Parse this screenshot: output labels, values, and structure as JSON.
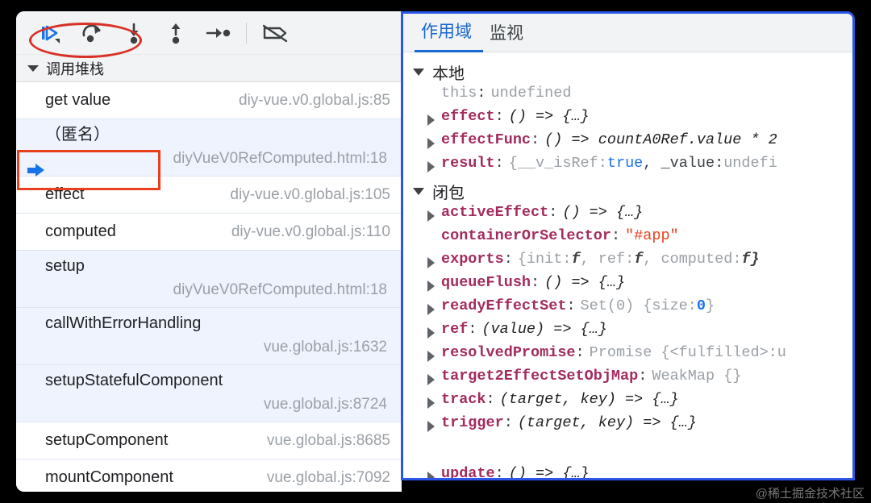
{
  "toolbar": {
    "buttons": [
      {
        "name": "resume-script-execution",
        "icon": "resume-icon"
      },
      {
        "name": "step-over-next-function-call",
        "icon": "step-over-icon"
      },
      {
        "name": "step-into-next-function-call",
        "icon": "step-into-icon"
      },
      {
        "name": "step-out-of-current-function",
        "icon": "step-out-icon"
      },
      {
        "name": "step",
        "icon": "step-icon"
      },
      {
        "name": "deactivate-breakpoints",
        "icon": "deactivate-breakpoints-icon"
      }
    ]
  },
  "call_stack": {
    "section_title": "调用堆栈",
    "expanded": true,
    "rows": [
      {
        "fn": "get value",
        "src": "diy-vue.v0.global.js:85",
        "layout": "one-line",
        "annotation": "ellipse"
      },
      {
        "fn": "（匿名）",
        "src": "diyVueV0RefComputed.html:18",
        "layout": "two-line",
        "annotation": ""
      },
      {
        "fn": "effect",
        "src": "diy-vue.v0.global.js:105",
        "layout": "one-line",
        "annotation": ""
      },
      {
        "fn": "computed",
        "src": "diy-vue.v0.global.js:110",
        "layout": "one-line",
        "annotation": "rect",
        "marker": "blue-arrow"
      },
      {
        "fn": "setup",
        "src": "diyVueV0RefComputed.html:18",
        "layout": "two-line",
        "annotation": ""
      },
      {
        "fn": "callWithErrorHandling",
        "src": "vue.global.js:1632",
        "layout": "two-line",
        "annotation": ""
      },
      {
        "fn": "setupStatefulComponent",
        "src": "vue.global.js:8724",
        "layout": "two-line",
        "annotation": ""
      },
      {
        "fn": "setupComponent",
        "src": "vue.global.js:8685",
        "layout": "one-line",
        "annotation": ""
      },
      {
        "fn": "mountComponent",
        "src": "vue.global.js:7092",
        "layout": "one-line",
        "annotation": ""
      }
    ]
  },
  "scope_panel": {
    "tabs": [
      {
        "label": "作用域",
        "active": true
      },
      {
        "label": "监视",
        "active": false
      }
    ],
    "groups": [
      {
        "label": "本地",
        "expanded": true,
        "props": [
          {
            "expandable": false,
            "name": "this",
            "name_dim": true,
            "value": "undefined",
            "value_style": "dim"
          },
          {
            "expandable": true,
            "name": "effect",
            "value": "() => {…}",
            "value_style": "fn"
          },
          {
            "expandable": true,
            "name": "effectFunc",
            "value": "() => countA0Ref.value * 2",
            "value_style": "fn"
          },
          {
            "expandable": true,
            "name": "result",
            "value_parts": [
              {
                "t": "{__v_isRef: ",
                "s": "dim"
              },
              {
                "t": "true",
                "s": "bool"
              },
              {
                "t": ", _value: ",
                "s": "plain"
              },
              {
                "t": "undefi",
                "s": "dim"
              }
            ]
          }
        ]
      },
      {
        "label": "闭包",
        "expanded": true,
        "props": [
          {
            "expandable": true,
            "name": "activeEffect",
            "value": "() => {…}",
            "value_style": "fn"
          },
          {
            "expandable": false,
            "name": "containerOrSelector",
            "value": "\"#app\"",
            "value_style": "str"
          },
          {
            "expandable": true,
            "name": "exports",
            "value_parts": [
              {
                "t": "{init: ",
                "s": "dim"
              },
              {
                "t": "f",
                "s": "italic-f"
              },
              {
                "t": ", ref: ",
                "s": "dim"
              },
              {
                "t": "f",
                "s": "italic-f"
              },
              {
                "t": ", computed: ",
                "s": "dim"
              },
              {
                "t": "f}",
                "s": "italic-f"
              }
            ]
          },
          {
            "expandable": true,
            "name": "queueFlush",
            "value": "() => {…}",
            "value_style": "fn"
          },
          {
            "expandable": true,
            "name": "readyEffectSet",
            "value_parts": [
              {
                "t": "Set(0) {size: ",
                "s": "dim"
              },
              {
                "t": "0",
                "s": "num"
              },
              {
                "t": "}",
                "s": "dim"
              }
            ]
          },
          {
            "expandable": true,
            "name": "ref",
            "value": "(value) => {…}",
            "value_style": "fn"
          },
          {
            "expandable": true,
            "name": "resolvedPromise",
            "value_parts": [
              {
                "t": "Promise {<fulfilled>: ",
                "s": "dim"
              },
              {
                "t": "u",
                "s": "dim"
              }
            ]
          },
          {
            "expandable": true,
            "name": "target2EffectSetObjMap",
            "value": "WeakMap {}",
            "value_style": "dim"
          },
          {
            "expandable": true,
            "name": "track",
            "value": "(target, key) => {…}",
            "value_style": "fn"
          },
          {
            "expandable": true,
            "name": "trigger",
            "value": "(target, key) => {…}",
            "value_style": "fn"
          },
          {
            "expandable": true,
            "name": "update",
            "value": "() => {…}",
            "value_style": "fn",
            "clipped": true
          }
        ]
      }
    ]
  },
  "watermark": "@稀土掘金技术社区",
  "colors": {
    "accent_blue": "#1967d2",
    "annotation_red": "#d93025",
    "annotation_rect": "#e8401f",
    "annotation_border_blue": "#2b55e6",
    "property_name": "#a32b5e",
    "string_value": "#e8401f"
  }
}
